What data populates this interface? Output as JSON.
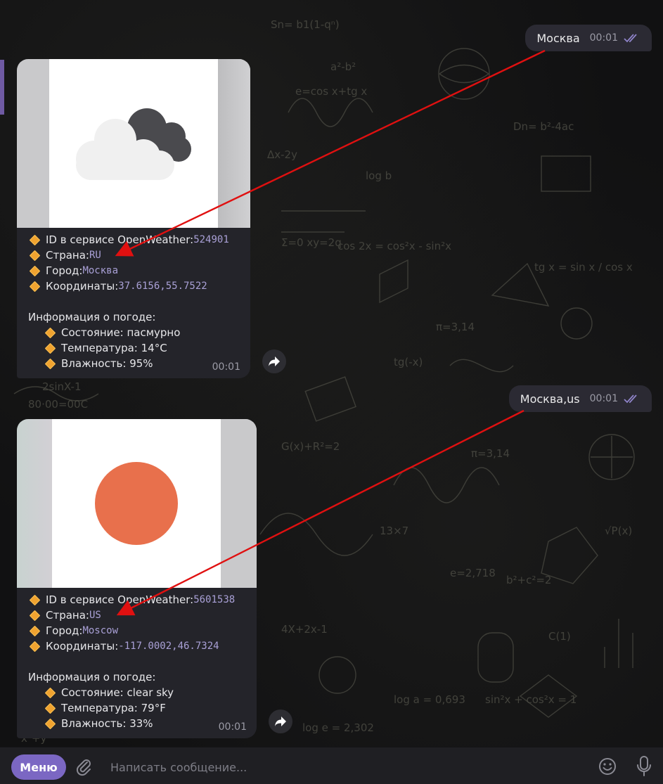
{
  "chat": {
    "messages": [
      {
        "out_text": "Москва",
        "out_time": "00:01",
        "reply": {
          "rows": [
            {
              "label": "ID в сервисе OpenWeather: ",
              "value": "524901"
            },
            {
              "label": "Страна: ",
              "value": "RU"
            },
            {
              "label": "Город: ",
              "value": "Москва"
            },
            {
              "label": "Координаты: ",
              "value": "37.6156,55.7522"
            }
          ],
          "weather_header": "Информация о погоде:",
          "weather_rows": [
            "Состояние: пасмурно",
            "Температура: 14°C",
            "Влажность: 95%"
          ],
          "time": "00:01",
          "image_icon": "cloudy-weather-icon"
        }
      },
      {
        "out_text": "Москва,us",
        "out_time": "00:01",
        "reply": {
          "rows": [
            {
              "label": "ID в сервисе OpenWeather: ",
              "value": "5601538"
            },
            {
              "label": "Страна: ",
              "value": "US"
            },
            {
              "label": "Город: ",
              "value": "Moscow"
            },
            {
              "label": "Координаты: ",
              "value": "-117.0002,46.7324"
            }
          ],
          "weather_header": "Информация о погоде:",
          "weather_rows": [
            "Состояние: clear sky",
            "Температура: 79°F",
            "Влажность: 33%"
          ],
          "time": "00:01",
          "image_icon": "sun-weather-icon"
        }
      }
    ]
  },
  "input_bar": {
    "menu_label": "Меню",
    "placeholder": "Написать сообщение..."
  },
  "colors": {
    "accent": "#7b67c3",
    "annotation_arrow": "#e01010",
    "sun": "#e8704c",
    "bullet": "#f0a330",
    "monospace_value": "#a9a0d6"
  },
  "icons": [
    "double-check-icon",
    "forward-icon",
    "attach-icon",
    "emoji-icon",
    "mic-icon",
    "diamond-bullet-icon"
  ]
}
